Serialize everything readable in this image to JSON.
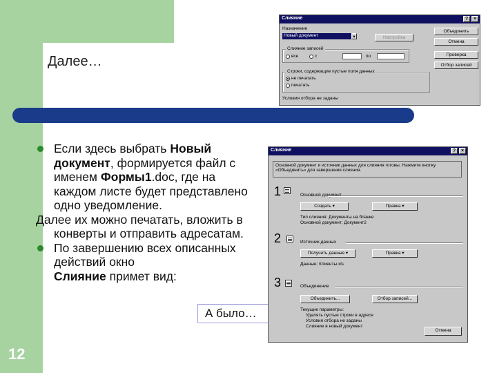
{
  "slide": {
    "title": "Далее…",
    "number": "12"
  },
  "body": {
    "p1": {
      "a": "Если здесь выбрать ",
      "b": "Новый документ",
      "c": ", формируется файл с именем ",
      "d": "Формы1",
      "e": ".doc, где на каждом листе будет представлено одно уведомление."
    },
    "p2": "Далее их можно печатать, вложить в конверты и отправить адресатам.",
    "p3": {
      "a": "По завершению всех описанных действий окно",
      "b": "Слияние",
      "c": " примет вид:"
    },
    "ref_link": "А было…"
  },
  "dialog1": {
    "title": "Слияние",
    "label1": "Назначение",
    "select_value": "Новый документ",
    "create_label": "Настройка",
    "buttons": [
      "Объединить",
      "Отмена",
      "Проверка",
      "Отбор записей"
    ],
    "group1": "Слияние записей",
    "opt_a": "все",
    "opt_b": "с",
    "opt_to": "по",
    "group2": "Строки, содержащие пустые поля данных",
    "opt_c": "не печатать",
    "opt_d": "печатать",
    "footer": "Условия отбора не заданы"
  },
  "dialog2": {
    "title": "Слияние",
    "instructions": "Основной документ и источник данных для слияния готовы. Нажмите кнопку «Объединить» для завершения слияния.",
    "step1": {
      "num": "1",
      "label": "Основной документ",
      "btn1": "Создать ▾",
      "btn2": "Правка ▾",
      "info1": "Тип слияния: Документы на бланке",
      "info2": "Основной документ: Документ2"
    },
    "step2": {
      "num": "2",
      "label": "Источник данных",
      "btn1": "Получить данные ▾",
      "btn2": "Правка ▾",
      "info": "Данные: Клиенты.xls"
    },
    "step3": {
      "num": "3",
      "label": "Объединение",
      "btn1": "Объединить...",
      "btn2": "Отбор записей...",
      "params": "Текущие параметры:",
      "p1": "Удалять пустые строки в адресе",
      "p2": "Условия отбора не заданы",
      "p3": "Слияние в новый документ"
    },
    "cancel": "Отмена"
  }
}
